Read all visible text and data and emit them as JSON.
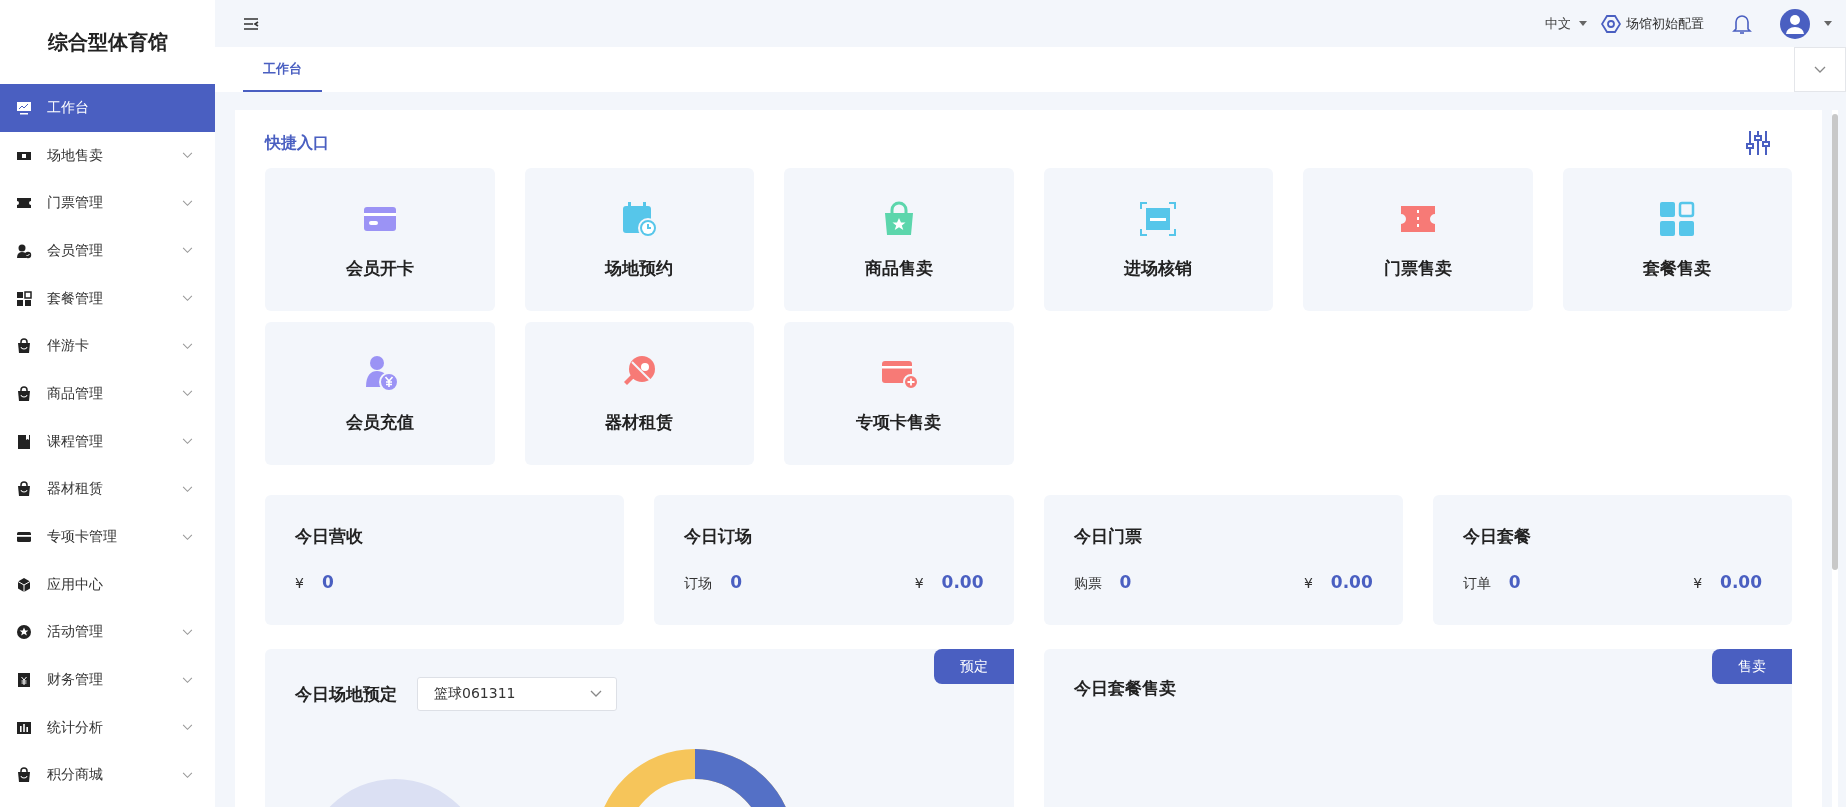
{
  "sidebar": {
    "title": "综合型体育馆",
    "items": [
      {
        "label": "工作台",
        "selected": true,
        "has_submenu": false
      },
      {
        "label": "场地售卖",
        "selected": false,
        "has_submenu": true
      },
      {
        "label": "门票管理",
        "selected": false,
        "has_submenu": true
      },
      {
        "label": "会员管理",
        "selected": false,
        "has_submenu": true
      },
      {
        "label": "套餐管理",
        "selected": false,
        "has_submenu": true
      },
      {
        "label": "伴游卡",
        "selected": false,
        "has_submenu": true
      },
      {
        "label": "商品管理",
        "selected": false,
        "has_submenu": true
      },
      {
        "label": "课程管理",
        "selected": false,
        "has_submenu": true
      },
      {
        "label": "器材租赁",
        "selected": false,
        "has_submenu": true
      },
      {
        "label": "专项卡管理",
        "selected": false,
        "has_submenu": true
      },
      {
        "label": "应用中心",
        "selected": false,
        "has_submenu": false
      },
      {
        "label": "活动管理",
        "selected": false,
        "has_submenu": true
      },
      {
        "label": "财务管理",
        "selected": false,
        "has_submenu": true
      },
      {
        "label": "统计分析",
        "selected": false,
        "has_submenu": true
      },
      {
        "label": "积分商城",
        "selected": false,
        "has_submenu": true
      }
    ]
  },
  "header": {
    "language": "中文",
    "config_link": "场馆初始配置"
  },
  "tabs": [
    {
      "label": "工作台",
      "selected": true
    }
  ],
  "quick_entry": {
    "title": "快捷入口",
    "items": [
      {
        "label": "会员开卡"
      },
      {
        "label": "场地预约"
      },
      {
        "label": "商品售卖"
      },
      {
        "label": "进场核销"
      },
      {
        "label": "门票售卖"
      },
      {
        "label": "套餐售卖"
      },
      {
        "label": "会员充值"
      },
      {
        "label": "器材租赁"
      },
      {
        "label": "专项卡售卖"
      }
    ]
  },
  "stats": [
    {
      "title": "今日营收",
      "rows": [
        {
          "label": "¥",
          "value": "0"
        }
      ]
    },
    {
      "title": "今日订场",
      "rows": [
        {
          "label": "订场",
          "value": "0"
        },
        {
          "label": "¥",
          "value": "0.00"
        }
      ]
    },
    {
      "title": "今日门票",
      "rows": [
        {
          "label": "购票",
          "value": "0"
        },
        {
          "label": "¥",
          "value": "0.00"
        }
      ]
    },
    {
      "title": "今日套餐",
      "rows": [
        {
          "label": "订单",
          "value": "0"
        },
        {
          "label": "¥",
          "value": "0.00"
        }
      ]
    }
  ],
  "booking_panel": {
    "title": "今日场地预定",
    "venue_select": "篮球061311",
    "button": "预定"
  },
  "package_panel": {
    "title": "今日套餐售卖",
    "button": "售卖"
  }
}
